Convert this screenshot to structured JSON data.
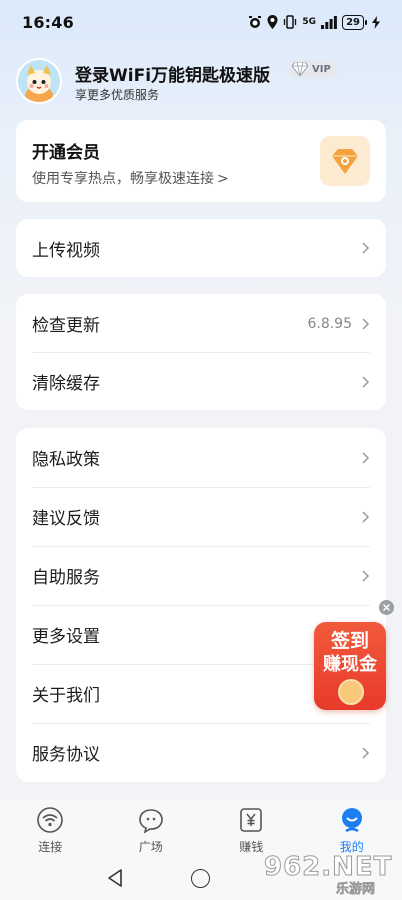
{
  "status_bar": {
    "time": "16:46",
    "network": "5G",
    "battery": "29"
  },
  "profile": {
    "title": "登录WiFi万能钥匙极速版",
    "vip_label": "VIP",
    "subtitle": "享更多优质服务"
  },
  "member_card": {
    "title": "开通会员",
    "subtitle": "使用专享热点，畅享极速连接",
    "subtitle_chevron": ">"
  },
  "menu": {
    "upload": "上传视频",
    "check_update": "检查更新",
    "version": "6.8.95",
    "clear_cache": "清除缓存",
    "privacy": "隐私政策",
    "feedback": "建议反馈",
    "self_service": "自助服务",
    "more_settings": "更多设置",
    "about": "关于我们",
    "agreement": "服务协议"
  },
  "float_ad": {
    "line1": "签到",
    "line2": "赚现金"
  },
  "tabs": [
    {
      "label": "连接",
      "icon": "wifi-icon"
    },
    {
      "label": "广场",
      "icon": "chat-bubble-icon"
    },
    {
      "label": "赚钱",
      "icon": "yuan-icon"
    },
    {
      "label": "我的",
      "icon": "person-icon"
    }
  ],
  "active_tab": "我的",
  "watermark": {
    "brand": "962.NET",
    "sub": "乐游网"
  },
  "colors": {
    "accent": "#1c7ef0",
    "ad_red": "#e83a2a",
    "member_icon_bg": "#fcebd0"
  }
}
